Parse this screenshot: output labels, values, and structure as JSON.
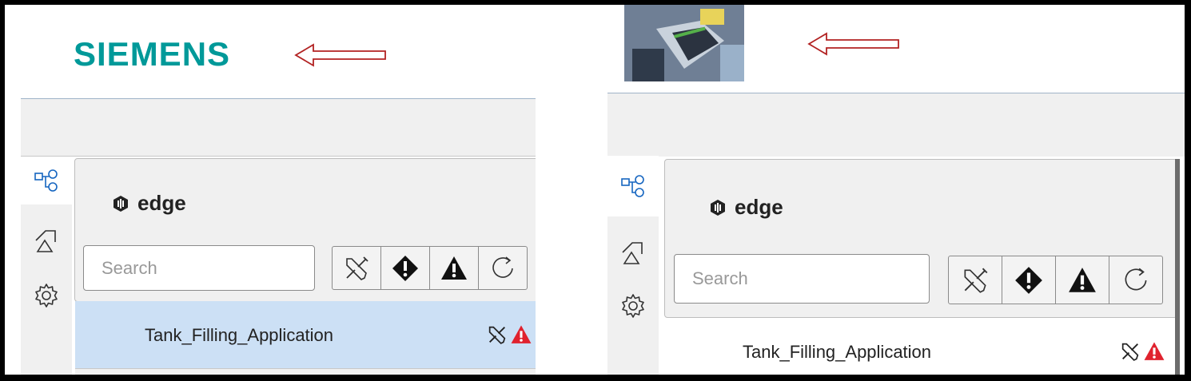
{
  "left": {
    "brand_text": "SIEMENS",
    "brand_color": "#009999",
    "tree_title": "edge",
    "search_placeholder": "Search",
    "row_label": "Tank_Filling_Application",
    "row_selected": true,
    "selected_color": "#cce0f5"
  },
  "right": {
    "tree_title": "edge",
    "search_placeholder": "Search",
    "row_label": "Tank_Filling_Application",
    "row_selected": false
  },
  "sidebar_icons": [
    "tree-view-icon",
    "shapes-icon",
    "gear-icon"
  ],
  "filter_icons": [
    "tools-icon",
    "error-diamond-icon",
    "warning-triangle-icon",
    "refresh-icon"
  ],
  "row_status_icons": [
    "tools-icon",
    "warning-triangle-icon"
  ],
  "annotation_arrow_color": "#b22222",
  "warning_color": "#e0222e"
}
